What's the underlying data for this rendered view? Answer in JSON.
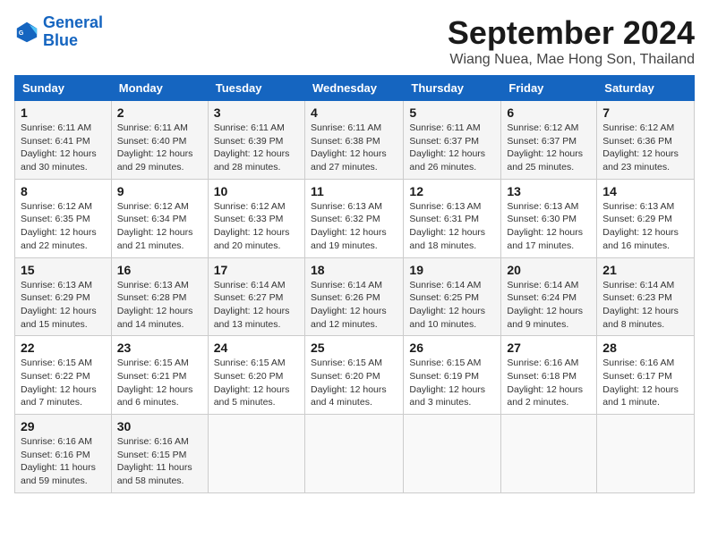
{
  "logo": {
    "line1": "General",
    "line2": "Blue"
  },
  "title": "September 2024",
  "location": "Wiang Nuea, Mae Hong Son, Thailand",
  "weekdays": [
    "Sunday",
    "Monday",
    "Tuesday",
    "Wednesday",
    "Thursday",
    "Friday",
    "Saturday"
  ],
  "weeks": [
    [
      {
        "day": "1",
        "sunrise": "Sunrise: 6:11 AM",
        "sunset": "Sunset: 6:41 PM",
        "daylight": "Daylight: 12 hours and 30 minutes."
      },
      {
        "day": "2",
        "sunrise": "Sunrise: 6:11 AM",
        "sunset": "Sunset: 6:40 PM",
        "daylight": "Daylight: 12 hours and 29 minutes."
      },
      {
        "day": "3",
        "sunrise": "Sunrise: 6:11 AM",
        "sunset": "Sunset: 6:39 PM",
        "daylight": "Daylight: 12 hours and 28 minutes."
      },
      {
        "day": "4",
        "sunrise": "Sunrise: 6:11 AM",
        "sunset": "Sunset: 6:38 PM",
        "daylight": "Daylight: 12 hours and 27 minutes."
      },
      {
        "day": "5",
        "sunrise": "Sunrise: 6:11 AM",
        "sunset": "Sunset: 6:37 PM",
        "daylight": "Daylight: 12 hours and 26 minutes."
      },
      {
        "day": "6",
        "sunrise": "Sunrise: 6:12 AM",
        "sunset": "Sunset: 6:37 PM",
        "daylight": "Daylight: 12 hours and 25 minutes."
      },
      {
        "day": "7",
        "sunrise": "Sunrise: 6:12 AM",
        "sunset": "Sunset: 6:36 PM",
        "daylight": "Daylight: 12 hours and 23 minutes."
      }
    ],
    [
      {
        "day": "8",
        "sunrise": "Sunrise: 6:12 AM",
        "sunset": "Sunset: 6:35 PM",
        "daylight": "Daylight: 12 hours and 22 minutes."
      },
      {
        "day": "9",
        "sunrise": "Sunrise: 6:12 AM",
        "sunset": "Sunset: 6:34 PM",
        "daylight": "Daylight: 12 hours and 21 minutes."
      },
      {
        "day": "10",
        "sunrise": "Sunrise: 6:12 AM",
        "sunset": "Sunset: 6:33 PM",
        "daylight": "Daylight: 12 hours and 20 minutes."
      },
      {
        "day": "11",
        "sunrise": "Sunrise: 6:13 AM",
        "sunset": "Sunset: 6:32 PM",
        "daylight": "Daylight: 12 hours and 19 minutes."
      },
      {
        "day": "12",
        "sunrise": "Sunrise: 6:13 AM",
        "sunset": "Sunset: 6:31 PM",
        "daylight": "Daylight: 12 hours and 18 minutes."
      },
      {
        "day": "13",
        "sunrise": "Sunrise: 6:13 AM",
        "sunset": "Sunset: 6:30 PM",
        "daylight": "Daylight: 12 hours and 17 minutes."
      },
      {
        "day": "14",
        "sunrise": "Sunrise: 6:13 AM",
        "sunset": "Sunset: 6:29 PM",
        "daylight": "Daylight: 12 hours and 16 minutes."
      }
    ],
    [
      {
        "day": "15",
        "sunrise": "Sunrise: 6:13 AM",
        "sunset": "Sunset: 6:29 PM",
        "daylight": "Daylight: 12 hours and 15 minutes."
      },
      {
        "day": "16",
        "sunrise": "Sunrise: 6:13 AM",
        "sunset": "Sunset: 6:28 PM",
        "daylight": "Daylight: 12 hours and 14 minutes."
      },
      {
        "day": "17",
        "sunrise": "Sunrise: 6:14 AM",
        "sunset": "Sunset: 6:27 PM",
        "daylight": "Daylight: 12 hours and 13 minutes."
      },
      {
        "day": "18",
        "sunrise": "Sunrise: 6:14 AM",
        "sunset": "Sunset: 6:26 PM",
        "daylight": "Daylight: 12 hours and 12 minutes."
      },
      {
        "day": "19",
        "sunrise": "Sunrise: 6:14 AM",
        "sunset": "Sunset: 6:25 PM",
        "daylight": "Daylight: 12 hours and 10 minutes."
      },
      {
        "day": "20",
        "sunrise": "Sunrise: 6:14 AM",
        "sunset": "Sunset: 6:24 PM",
        "daylight": "Daylight: 12 hours and 9 minutes."
      },
      {
        "day": "21",
        "sunrise": "Sunrise: 6:14 AM",
        "sunset": "Sunset: 6:23 PM",
        "daylight": "Daylight: 12 hours and 8 minutes."
      }
    ],
    [
      {
        "day": "22",
        "sunrise": "Sunrise: 6:15 AM",
        "sunset": "Sunset: 6:22 PM",
        "daylight": "Daylight: 12 hours and 7 minutes."
      },
      {
        "day": "23",
        "sunrise": "Sunrise: 6:15 AM",
        "sunset": "Sunset: 6:21 PM",
        "daylight": "Daylight: 12 hours and 6 minutes."
      },
      {
        "day": "24",
        "sunrise": "Sunrise: 6:15 AM",
        "sunset": "Sunset: 6:20 PM",
        "daylight": "Daylight: 12 hours and 5 minutes."
      },
      {
        "day": "25",
        "sunrise": "Sunrise: 6:15 AM",
        "sunset": "Sunset: 6:20 PM",
        "daylight": "Daylight: 12 hours and 4 minutes."
      },
      {
        "day": "26",
        "sunrise": "Sunrise: 6:15 AM",
        "sunset": "Sunset: 6:19 PM",
        "daylight": "Daylight: 12 hours and 3 minutes."
      },
      {
        "day": "27",
        "sunrise": "Sunrise: 6:16 AM",
        "sunset": "Sunset: 6:18 PM",
        "daylight": "Daylight: 12 hours and 2 minutes."
      },
      {
        "day": "28",
        "sunrise": "Sunrise: 6:16 AM",
        "sunset": "Sunset: 6:17 PM",
        "daylight": "Daylight: 12 hours and 1 minute."
      }
    ],
    [
      {
        "day": "29",
        "sunrise": "Sunrise: 6:16 AM",
        "sunset": "Sunset: 6:16 PM",
        "daylight": "Daylight: 11 hours and 59 minutes."
      },
      {
        "day": "30",
        "sunrise": "Sunrise: 6:16 AM",
        "sunset": "Sunset: 6:15 PM",
        "daylight": "Daylight: 11 hours and 58 minutes."
      },
      null,
      null,
      null,
      null,
      null
    ]
  ]
}
